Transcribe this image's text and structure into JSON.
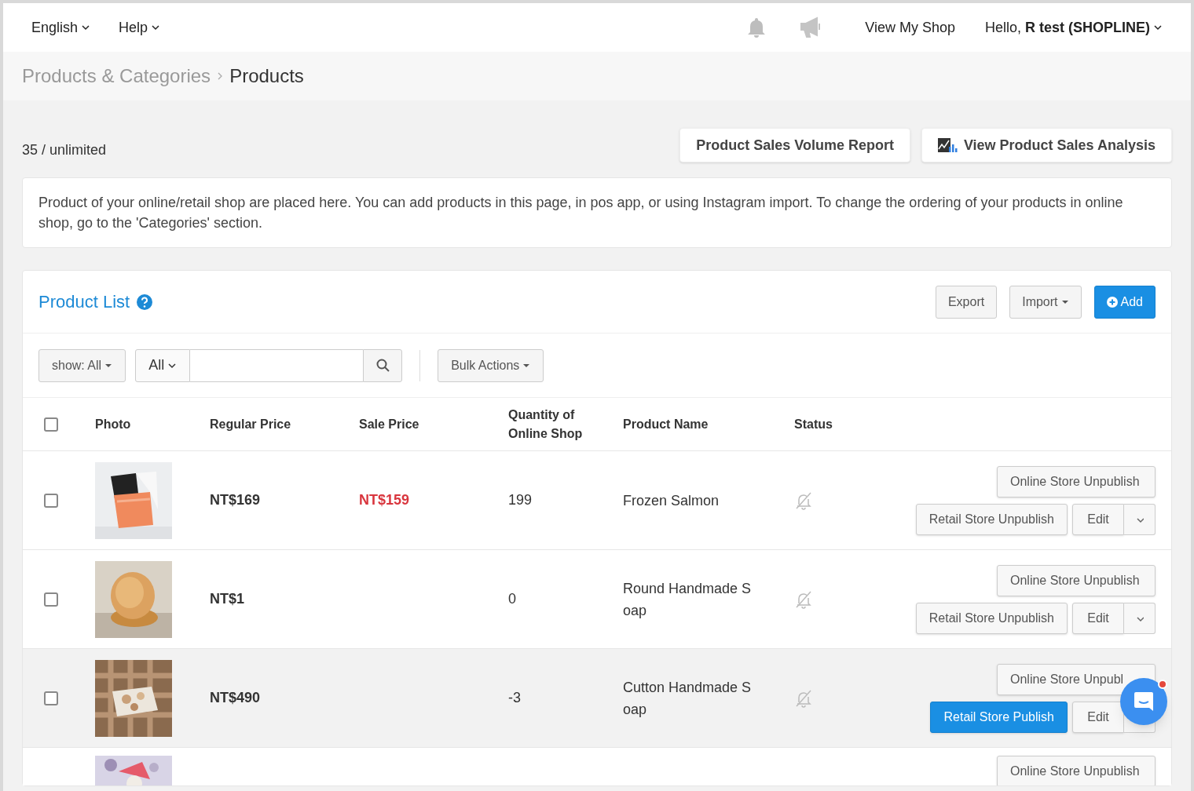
{
  "top_bar": {
    "menus": [
      {
        "label": "English"
      },
      {
        "label": "Help"
      }
    ],
    "view_shop": "View My Shop",
    "greeting": "Hello, **R test (SHOPLINE)**"
  },
  "breadcrumb": [
    "Products & Categories",
    "Products"
  ],
  "quota": "35 / unlimited",
  "report_buttons": [
    {
      "label": "Product Sales Volume Report",
      "icon": false
    },
    {
      "label": "View Product Sales Analysis",
      "icon": true
    }
  ],
  "notice": "Product of your online/retail shop are placed here. You can add products in this page, in pos app, or using Instagram import. To change the ordering of your products in online shop, go to the 'Categories' section.",
  "product_list": {
    "title": "Product List",
    "buttons": [
      {
        "label": "Export",
        "kind": "plain"
      },
      {
        "label": "Import",
        "kind": "dropdown"
      },
      {
        "label": "Add",
        "kind": "primary"
      }
    ],
    "filters": {
      "show": "show: All",
      "category": "All",
      "bulk": "Bulk Actions"
    },
    "columns": [
      "Photo",
      "Regular Price",
      "Sale Price",
      "Quantity of Online Shop",
      "Product Name",
      "Status"
    ],
    "header_checked": false,
    "rows": [
      {
        "kind": "full",
        "checked": false,
        "hovered": false,
        "regular_price": "NT$169",
        "sale_price": "NT$159",
        "quantity": "199",
        "name": "Frozen Salmon",
        "online_button": "Online Store Unpublish",
        "retail_published": true,
        "retail_button": "Retail Store Unpublish",
        "edit": "Edit",
        "caret_shown": true
      },
      {
        "kind": "full",
        "checked": false,
        "hovered": false,
        "regular_price": "NT$1",
        "sale_price": "",
        "quantity": "0",
        "name": "Round Handmade S oap",
        "online_button": "Online Store Unpublish",
        "retail_published": true,
        "retail_button": "Retail Store Unpublish",
        "edit": "Edit",
        "caret_shown": true
      },
      {
        "kind": "full",
        "checked": false,
        "hovered": true,
        "regular_price": "NT$490",
        "sale_price": "",
        "quantity": "-3",
        "name": "Cutton Handmade S oap",
        "online_button": "Online Store Unpubl",
        "retail_published": false,
        "retail_button": "Retail Store Publish",
        "edit": "Edit",
        "caret_shown": false
      },
      {
        "kind": "cut",
        "hovered": false,
        "online_button": "Online Store Unpublish"
      }
    ]
  },
  "chat_badge": true
}
